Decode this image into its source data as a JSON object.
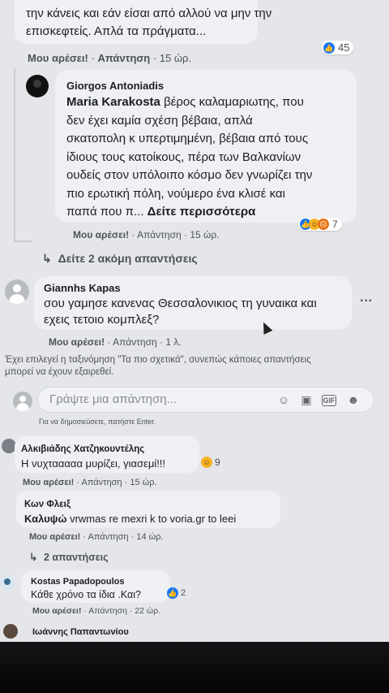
{
  "top_comment": {
    "text_line1": "την κάνεις και εάν είσαι από αλλού να μην την",
    "text_line2": "επισκεφτείς. Απλά τα πράγματα...",
    "like": "Μου αρέσει!",
    "reply": "Απάντηση",
    "time": "15 ώρ.",
    "reaction_count": "45"
  },
  "reply_giorgos": {
    "author": "Giorgos Antoniadis",
    "mention": "Maria Karakosta",
    "line1": "βέρος καλαμαριωτης, που",
    "line2": "δεν έχει καμία σχέση βέβαια, απλά",
    "line3": "σκατοπολη κ υπερτιμημένη, βέβαια από τους",
    "line4": "ίδιους τους κατοίκους, πέρα των Βαλκανίων",
    "line5": "ουδείς στον υπόλοιπο κόσμο δεν γνωρίζει την",
    "line6": "πιο ερωτική πόλη, νούμερο ένα κλισέ και",
    "line7": "παπά που π...",
    "see_more": "Δείτε περισσότερα",
    "like": "Μου αρέσει!",
    "reply": "Απάντηση",
    "time": "15 ώρ.",
    "reaction_count": "7"
  },
  "more_replies": "Δείτε 2 ακόμη απαντήσεις",
  "reply_giannhs": {
    "author": "Giannhs Kapas",
    "line1": "σου γαμησε κανενας Θεσσαλονικιος τη γυναικα και",
    "line2": "εχεις τετοιο κομπλεξ?",
    "like": "Μου αρέσει!",
    "reply": "Απάντηση",
    "time": "1 λ.",
    "more_options": "···"
  },
  "sort_notice_line1": "Έχει επιλεγεί η ταξινόμηση \"Τα πιο σχετικά\", συνεπώς κάποιες απαντήσεις",
  "sort_notice_line2": "μπορεί να έχουν εξαιρεθεί.",
  "composer": {
    "placeholder": "Γράψτε μια απάντηση...",
    "hint": "Για να δημοσιεύσετε, πατήστε Enter."
  },
  "comment_alkiviadis": {
    "author": "Αλκιβιάδης Χατζηκουντέλης",
    "text": "Η νυχτααααα μυρίζει, γιασεμί!!!",
    "reaction_count": "9",
    "like": "Μου αρέσει!",
    "reply": "Απάντηση",
    "time": "15 ώρ."
  },
  "comment_kon": {
    "author": "Κων Φλειξ",
    "mention": "Καλυψώ",
    "text": "vrwmas re mexri k to voria.gr to leei",
    "like": "Μου αρέσει!",
    "reply": "Απάντηση",
    "time": "14 ώρ.",
    "replies": "2 απαντήσεις"
  },
  "comment_kostas": {
    "author": "Kostas Papadopoulos",
    "text": "Κάθε χρόνο τα ίδια .Και?",
    "reaction_count": "2",
    "like": "Μου αρέσει!",
    "reply": "Απάντηση",
    "time": "22 ώρ."
  },
  "next_author": "Ιωάννης Παπαντωνίου",
  "sep": "·"
}
